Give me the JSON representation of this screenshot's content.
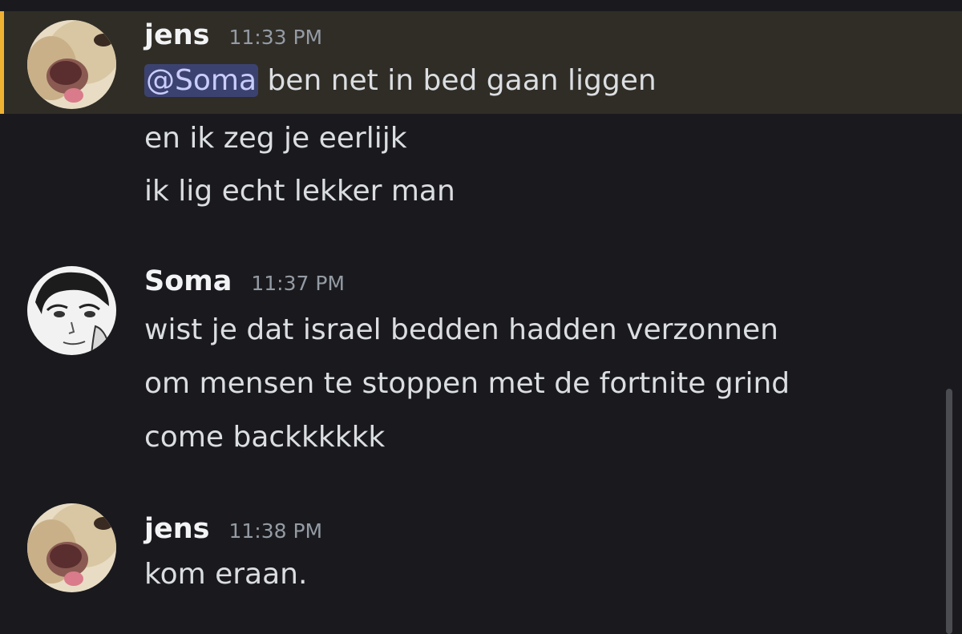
{
  "messages": [
    {
      "author": "jens",
      "time": "11:33 PM",
      "mention": "@Soma",
      "first_line_rest": " ben net in bed gaan liggen",
      "lines": [
        "en ik zeg je eerlijk",
        "ik lig echt lekker man"
      ],
      "avatar_icon": "dog-avatar-icon"
    },
    {
      "author": "Soma",
      "time": "11:37 PM",
      "lines": [
        "wist je dat israel bedden hadden verzonnen",
        "om mensen te stoppen met de fortnite grind",
        "come backkkkkk"
      ],
      "avatar_icon": "manga-avatar-icon"
    },
    {
      "author": "jens",
      "time": "11:38 PM",
      "lines": [
        "kom eraan."
      ],
      "avatar_icon": "dog-avatar-icon"
    }
  ],
  "colors": {
    "background": "#1a1a1e",
    "mention_highlight": "#302d27",
    "mention_bar": "#f0b232",
    "mention_pill": "#3c4270",
    "text": "#dbdee1",
    "username": "#f2f3f5",
    "timestamp": "#949ba4"
  }
}
